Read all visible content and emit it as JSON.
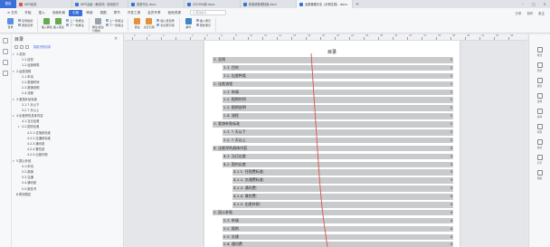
{
  "tabbar": {
    "home": "首页",
    "tabs": [
      {
        "label": "WPS稻壳",
        "color": "#e0533f",
        "active": false
      },
      {
        "label": "WPS高级（敏感词）使用技巧",
        "color": "#3b6fd8",
        "active": false
      },
      {
        "label": "英语作业.docx",
        "color": "#3b6fd8",
        "active": false
      },
      {
        "label": "2023Ms稿.docx",
        "color": "#3b6fd8",
        "active": false
      },
      {
        "label": "新客服管理制度.docx",
        "color": "#3b6fd8",
        "active": false
      },
      {
        "label": "全套管理办法（示例文档）.docx",
        "color": "#3b6fd8",
        "active": true
      }
    ],
    "new_tab": "+",
    "window_buttons": [
      "–",
      "□",
      "×"
    ]
  },
  "menubar": {
    "items": [
      "≡ 文件",
      "开始",
      "插入",
      "页面布局",
      "引用",
      "审阅",
      "视图",
      "章节",
      "开发工具",
      "会员专享",
      "稻壳资源"
    ],
    "active_index": 4,
    "search_placeholder": "Q 查找命令",
    "right_items": [
      "分享",
      "协作",
      "批注"
    ]
  },
  "ribbon": {
    "groups": [
      {
        "big": [
          {
            "label": "目录",
            "color": "#5b8fe0"
          }
        ],
        "small": [
          [
            "目录级别",
            "更新目录"
          ]
        ]
      },
      {
        "big": [
          {
            "label": "插入脚注",
            "color": "#6aa84f"
          },
          {
            "label": "插入尾注",
            "color": "#6aa84f"
          }
        ],
        "small": [
          [
            "上一条脚注",
            "下一条脚注"
          ]
        ]
      },
      {
        "big": [
          {
            "label": "脚注/尾注分隔线",
            "color": "#9aa3ad"
          }
        ],
        "small": [
          [
            "上一条尾注",
            "下一条尾注"
          ]
        ]
      },
      {
        "big": [
          {
            "label": "题注",
            "color": "#e69138"
          },
          {
            "label": "交叉引用",
            "color": "#e69138"
          }
        ],
        "small": [
          [
            "插入表目录",
            "标记索引项"
          ]
        ]
      },
      {
        "big": [
          {
            "label": "邮件",
            "color": "#3d85c6"
          }
        ],
        "small": [
          [
            "插入索引",
            "更新索引"
          ]
        ]
      }
    ]
  },
  "navpane": {
    "title": "目录",
    "close": "×",
    "smart_label": "智能识别目录",
    "items": [
      {
        "label": "1.总则",
        "indent": 0,
        "arrow": "▾"
      },
      {
        "label": "1.1.目的",
        "indent": 2,
        "arrow": ""
      },
      {
        "label": "1.2.运营种类",
        "indent": 2,
        "arrow": ""
      },
      {
        "label": "2.运营流程",
        "indent": 0,
        "arrow": "▾"
      },
      {
        "label": "2.1.申请",
        "indent": 2,
        "arrow": ""
      },
      {
        "label": "2.2.报销时间",
        "indent": 2,
        "arrow": ""
      },
      {
        "label": "2.3.报销说明",
        "indent": 2,
        "arrow": ""
      },
      {
        "label": "2.4.流程",
        "indent": 2,
        "arrow": ""
      },
      {
        "label": "3.差旅补贴标准",
        "indent": 0,
        "arrow": "▾"
      },
      {
        "label": "3.1.7 天以下",
        "indent": 2,
        "arrow": ""
      },
      {
        "label": "3.2.7 天以上",
        "indent": 2,
        "arrow": ""
      },
      {
        "label": "4.出差岸的具体内容",
        "indent": 0,
        "arrow": "▾"
      },
      {
        "label": "4.1.当日出差",
        "indent": 2,
        "arrow": ""
      },
      {
        "label": "4.2.国内出差",
        "indent": 2,
        "arrow": "▾"
      },
      {
        "label": "4.2.1.住宿费标准",
        "indent": 4,
        "arrow": ""
      },
      {
        "label": "4.2.2.交通费标准",
        "indent": 4,
        "arrow": ""
      },
      {
        "label": "4.2.3.通讯费",
        "indent": 4,
        "arrow": ""
      },
      {
        "label": "4.2.4.餐饮费",
        "indent": 4,
        "arrow": ""
      },
      {
        "label": "4.2.5.出差补助",
        "indent": 4,
        "arrow": ""
      },
      {
        "label": "5.国公补贴",
        "indent": 0,
        "arrow": "▾"
      },
      {
        "label": "5.1.申请",
        "indent": 2,
        "arrow": ""
      },
      {
        "label": "5.2.报销",
        "indent": 2,
        "arrow": ""
      },
      {
        "label": "5.3.交通",
        "indent": 2,
        "arrow": ""
      },
      {
        "label": "5.4.通讯费",
        "indent": 2,
        "arrow": ""
      },
      {
        "label": "5.5.报告书",
        "indent": 2,
        "arrow": ""
      },
      {
        "label": "6.附则规定",
        "indent": 0,
        "arrow": ""
      }
    ]
  },
  "ruler": {
    "numbers": [
      "6",
      "4",
      "2",
      "",
      "2",
      "4",
      "6",
      "8",
      "10",
      "12",
      "14",
      "16",
      "18",
      "20",
      "22",
      "24",
      "26",
      "28",
      "30",
      "32",
      "34",
      "36",
      "38",
      "40",
      "42",
      "44",
      "46"
    ]
  },
  "document": {
    "toc_title": "目录",
    "entries": [
      {
        "text": "1. 总则",
        "indent": 0,
        "page": "1"
      },
      {
        "text": "1.1. 目的",
        "indent": 1,
        "page": "1"
      },
      {
        "text": "1.2. 出差种类",
        "indent": 1,
        "page": "1"
      },
      {
        "text": "2. 出差流程",
        "indent": 0,
        "page": "1"
      },
      {
        "text": "2.1. 申请",
        "indent": 1,
        "page": "1"
      },
      {
        "text": "2.2. 报销时间",
        "indent": 1,
        "page": "1"
      },
      {
        "text": "2.3. 报销说明",
        "indent": 1,
        "page": "1"
      },
      {
        "text": "2.4. 流程",
        "indent": 1,
        "page": "1"
      },
      {
        "text": "3. 差旅补贴标准",
        "indent": 0,
        "page": "2"
      },
      {
        "text": "3.1. 7 天以下",
        "indent": 1,
        "page": "2"
      },
      {
        "text": "3.2. 7 天以上",
        "indent": 1,
        "page": "2"
      },
      {
        "text": "4. 出差岸的具体内容",
        "indent": 0,
        "page": "3"
      },
      {
        "text": "4.1. 当日出差",
        "indent": 1,
        "page": "3"
      },
      {
        "text": "4.2. 国内出差",
        "indent": 1,
        "page": "3"
      },
      {
        "text": "4.2.1. 住宿费标准：",
        "indent": 2,
        "page": "3"
      },
      {
        "text": "4.2.2. 交通费标准：",
        "indent": 2,
        "page": "3"
      },
      {
        "text": "4.2.3. 通讯费：",
        "indent": 2,
        "page": "4"
      },
      {
        "text": "4.2.4. 餐饮费：",
        "indent": 2,
        "page": "4"
      },
      {
        "text": "4.2.5. 出差补助：",
        "indent": 2,
        "page": "4"
      },
      {
        "text": "5. 因公补贴",
        "indent": 0,
        "page": "4"
      },
      {
        "text": "5.1. 申请",
        "indent": 1,
        "page": "4"
      },
      {
        "text": "5.2. 报销",
        "indent": 1,
        "page": "4"
      },
      {
        "text": "5.3. 交通",
        "indent": 1,
        "page": "4"
      },
      {
        "text": "5.4. 通讯费",
        "indent": 1,
        "page": "4"
      },
      {
        "text": "5.5. 报告书",
        "indent": 1,
        "page": "4"
      }
    ]
  },
  "rightbar": {
    "items": [
      {
        "label": "样式",
        "icon": "style-icon"
      },
      {
        "label": "形状",
        "icon": "shape-icon"
      },
      {
        "label": "属性",
        "icon": "properties-icon"
      },
      {
        "label": "选择",
        "icon": "select-icon"
      },
      {
        "label": "素材",
        "icon": "material-icon"
      },
      {
        "label": "划词",
        "icon": "highlight-icon"
      },
      {
        "label": "格式",
        "icon": "format-icon"
      },
      {
        "label": "分享",
        "icon": "share-icon"
      },
      {
        "label": "帮助",
        "icon": "help-icon"
      }
    ]
  },
  "colors": {
    "accent": "#3b6fd8",
    "toc_highlight": "#c9cacc",
    "red_mark": "#d9534f"
  }
}
